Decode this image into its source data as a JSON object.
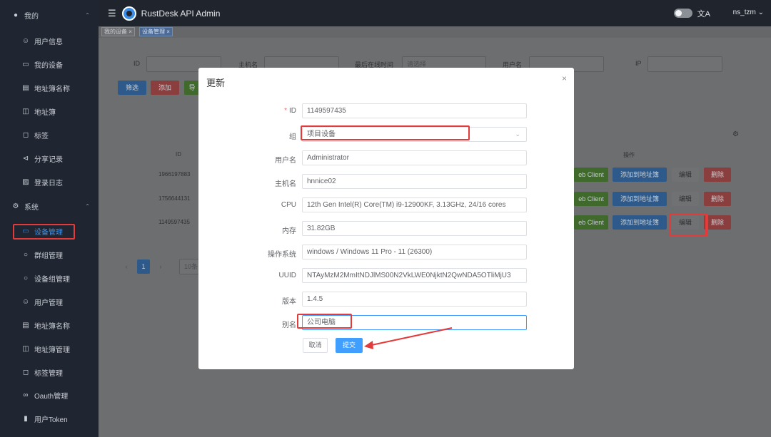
{
  "sidebar": {
    "my_group": "我的",
    "items_my": [
      {
        "label": "用户信息",
        "icon": "user-icon"
      },
      {
        "label": "我的设备",
        "icon": "monitor-icon"
      },
      {
        "label": "地址簿名称",
        "icon": "book-icon"
      },
      {
        "label": "地址簿",
        "icon": "book-icon"
      },
      {
        "label": "标签",
        "icon": "tag-icon"
      },
      {
        "label": "分享记录",
        "icon": "share-icon"
      },
      {
        "label": "登录日志",
        "icon": "log-icon"
      }
    ],
    "system_group": "系统",
    "items_sys": [
      {
        "label": "设备管理",
        "icon": "monitor-icon"
      },
      {
        "label": "群组管理",
        "icon": "chat-icon"
      },
      {
        "label": "设备组管理",
        "icon": "chat-icon"
      },
      {
        "label": "用户管理",
        "icon": "user-icon"
      },
      {
        "label": "地址簿名称",
        "icon": "book-icon"
      },
      {
        "label": "地址簿管理",
        "icon": "book-icon"
      },
      {
        "label": "标签管理",
        "icon": "tag-icon"
      },
      {
        "label": "Oauth管理",
        "icon": "link-icon"
      },
      {
        "label": "用户Token",
        "icon": "ticket-icon"
      }
    ]
  },
  "header": {
    "title": "RustDesk API Admin",
    "user": "ns_tzm"
  },
  "tabs": [
    {
      "label": "我的设备 ×"
    },
    {
      "label": "设备管理 ×"
    }
  ],
  "filters": {
    "id_label": "ID",
    "hostname_label": "主机名",
    "last_online_label": "最后在线时间",
    "last_online_placeholder": "请选择",
    "username_label": "用户名",
    "ip_label": "IP"
  },
  "bg_buttons": {
    "filter": "筛选",
    "add": "添加",
    "third": "导"
  },
  "table": {
    "col_id": "ID",
    "col_actions": "操作",
    "rows": [
      {
        "id": "1966197883",
        "web": "eb Client",
        "add_ab": "添加到地址簿",
        "edit": "编辑",
        "del": "删除"
      },
      {
        "id": "1756644131",
        "web": "eb Client",
        "add_ab": "添加到地址簿",
        "edit": "编辑",
        "del": "删除"
      },
      {
        "id": "1149597435",
        "web": "eb Client",
        "add_ab": "添加到地址簿",
        "edit": "编辑",
        "del": "删除"
      }
    ]
  },
  "pagination": {
    "page": "1",
    "size": "10条"
  },
  "modal": {
    "title": "更新",
    "close": "×",
    "fields": {
      "id": {
        "label": "ID",
        "value": "1149597435"
      },
      "group": {
        "label": "组",
        "value": "项目设备"
      },
      "username": {
        "label": "用户名",
        "value": "Administrator"
      },
      "hostname": {
        "label": "主机名",
        "value": "hnnice02"
      },
      "cpu": {
        "label": "CPU",
        "value": "12th Gen Intel(R) Core(TM) i9-12900KF, 3.13GHz, 24/16 cores"
      },
      "memory": {
        "label": "内存",
        "value": "31.82GB"
      },
      "os": {
        "label": "操作系统",
        "value": "windows / Windows 11 Pro - 11 (26300)"
      },
      "uuid": {
        "label": "UUID",
        "value": "NTAyMzM2MmItNDJlMS00N2VkLWE0NjktN2QwNDA5OTliMjU3"
      },
      "version": {
        "label": "版本",
        "value": "1.4.5"
      },
      "alias": {
        "label": "别名",
        "value": "公司电脑"
      }
    },
    "cancel": "取消",
    "submit": "提交"
  },
  "colors": {
    "primary": "#409eff",
    "danger": "#f56c6c",
    "success": "#67c23a",
    "highlight": "#e33a3a"
  }
}
